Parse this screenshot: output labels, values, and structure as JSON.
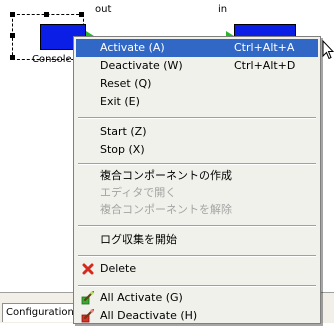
{
  "editor": {
    "component_left": {
      "label": "Console",
      "port_label": "out"
    },
    "component_right": {
      "port_label": "in"
    }
  },
  "bottom_panel": {
    "tab_label": "Configuration"
  },
  "context_menu": {
    "groups": [
      {
        "items": [
          {
            "label": "Activate (A)",
            "accelerator": "Ctrl+Alt+A",
            "state": "highlighted"
          },
          {
            "label": "Deactivate (W)",
            "accelerator": "Ctrl+Alt+D",
            "state": "normal"
          },
          {
            "label": "Reset (Q)",
            "accelerator": "",
            "state": "normal"
          },
          {
            "label": "Exit (E)",
            "accelerator": "",
            "state": "normal"
          }
        ]
      },
      {
        "items": [
          {
            "label": "Start (Z)",
            "accelerator": "",
            "state": "normal"
          },
          {
            "label": "Stop (X)",
            "accelerator": "",
            "state": "normal"
          }
        ]
      },
      {
        "items": [
          {
            "label": "複合コンポーネントの作成",
            "accelerator": "",
            "state": "normal"
          },
          {
            "label": "エディタで開く",
            "accelerator": "",
            "state": "disabled"
          },
          {
            "label": "複合コンポーネントを解除",
            "accelerator": "",
            "state": "disabled"
          }
        ]
      },
      {
        "items": [
          {
            "label": "ログ収集を開始",
            "accelerator": "",
            "state": "normal"
          }
        ]
      },
      {
        "items": [
          {
            "label": "Delete",
            "accelerator": "",
            "state": "normal",
            "icon": "red-x-icon"
          }
        ]
      },
      {
        "items": [
          {
            "label": "All Activate (G)",
            "accelerator": "",
            "state": "normal",
            "icon": "all-activate-icon"
          },
          {
            "label": "All Deactivate (H)",
            "accelerator": "",
            "state": "normal",
            "icon": "all-deactivate-icon"
          }
        ]
      }
    ]
  },
  "colors": {
    "highlight": "#3168c6",
    "component_fill": "#0a1ee6",
    "port_fill": "#2bb52b",
    "menu_background": "#f1f1ec",
    "disabled_text": "#a3a3a3"
  }
}
